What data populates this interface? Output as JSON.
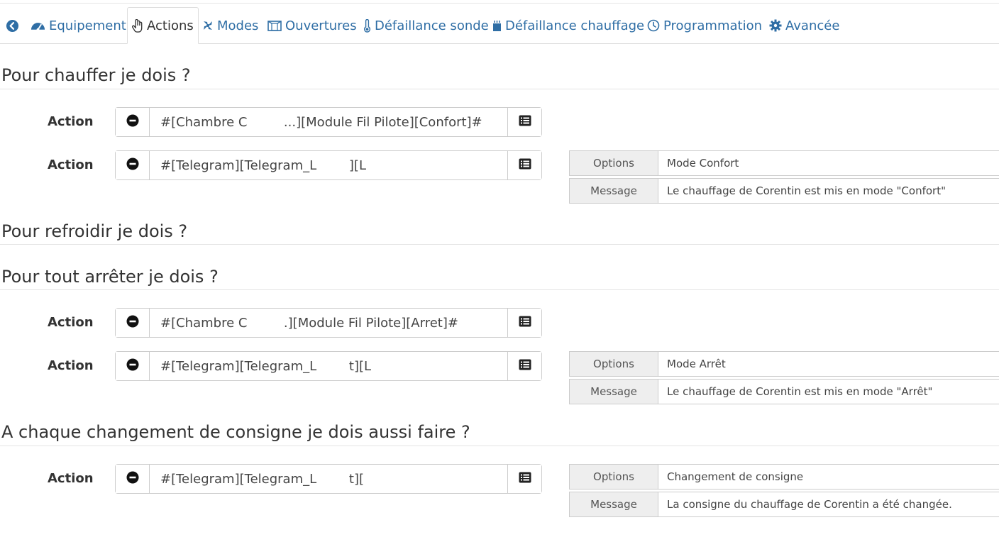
{
  "tabs": [
    {
      "label": "",
      "icon": "back-arrow-circle-icon"
    },
    {
      "label": "Equipement",
      "icon": "tachometer-icon"
    },
    {
      "label": "Actions",
      "icon": "hand-pointer-icon"
    },
    {
      "label": "Modes",
      "icon": "fan-icon"
    },
    {
      "label": "Ouvertures",
      "icon": "window-icon"
    },
    {
      "label": "Défaillance sonde",
      "icon": "thermometer-icon"
    },
    {
      "label": "Défaillance chauffage",
      "icon": "heater-icon"
    },
    {
      "label": "Programmation",
      "icon": "clock-icon"
    },
    {
      "label": "Avancée",
      "icon": "cog-icon"
    }
  ],
  "sections": {
    "heat": {
      "title": "Pour chauffer je dois ?",
      "actions": [
        {
          "label": "Action",
          "value": "#[Chambre C         ...][Module Fil Pilote][Confort]#"
        },
        {
          "label": "Action",
          "value": "#[Telegram][Telegram_L        ][L",
          "options_label": "Options",
          "options_value": "Mode Confort",
          "message_label": "Message",
          "message_value": "Le chauffage de Corentin est mis en mode \"Confort\""
        }
      ]
    },
    "cool": {
      "title": "Pour refroidir je dois ?"
    },
    "stop": {
      "title": "Pour tout arrêter je dois ?",
      "actions": [
        {
          "label": "Action",
          "value": "#[Chambre C         .][Module Fil Pilote][Arret]#"
        },
        {
          "label": "Action",
          "value": "#[Telegram][Telegram_L        t][L",
          "options_label": "Options",
          "options_value": "Mode Arrêt",
          "message_label": "Message",
          "message_value": "Le chauffage de Corentin est mis en mode \"Arrêt\""
        }
      ]
    },
    "setpoint": {
      "title": "A chaque changement de consigne je dois aussi faire ?",
      "actions": [
        {
          "label": "Action",
          "value": "#[Telegram][Telegram_L        t][",
          "options_label": "Options",
          "options_value": "Changement de consigne",
          "message_label": "Message",
          "message_value": "La consigne du chauffage de Corentin a été changée."
        }
      ]
    }
  },
  "colors": {
    "link": "#2f6ea5",
    "text": "#333333",
    "border": "#cccccc",
    "addon_bg": "#eeeeee"
  }
}
